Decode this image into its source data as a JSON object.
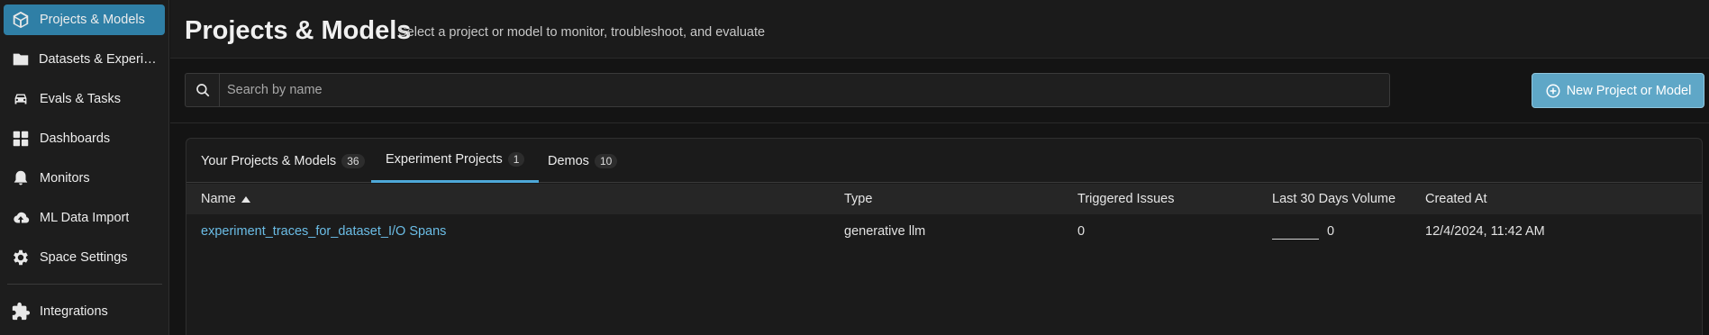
{
  "sidebar": {
    "items": [
      {
        "label": "Projects & Models",
        "icon": "cube-icon",
        "active": true
      },
      {
        "label": "Datasets & Experiments",
        "icon": "folder-icon",
        "active": false
      },
      {
        "label": "Evals & Tasks",
        "icon": "car-icon",
        "active": false
      },
      {
        "label": "Dashboards",
        "icon": "grid-icon",
        "active": false
      },
      {
        "label": "Monitors",
        "icon": "bell-icon",
        "active": false
      },
      {
        "label": "ML Data Import",
        "icon": "cloud-upload-icon",
        "active": false
      },
      {
        "label": "Space Settings",
        "icon": "gear-icon",
        "active": false
      },
      {
        "label": "Integrations",
        "icon": "puzzle-icon",
        "active": false
      }
    ]
  },
  "header": {
    "title": "Projects & Models",
    "subtitle": "Select a project or model to monitor, troubleshoot, and evaluate"
  },
  "search": {
    "placeholder": "Search by name",
    "value": ""
  },
  "actions": {
    "new_label": "New Project or Model"
  },
  "tabs": [
    {
      "label": "Your Projects & Models",
      "count": "36",
      "active": false
    },
    {
      "label": "Experiment Projects",
      "count": "1",
      "active": true
    },
    {
      "label": "Demos",
      "count": "10",
      "active": false
    }
  ],
  "table": {
    "columns": [
      "Name",
      "Type",
      "Triggered Issues",
      "Last 30 Days Volume",
      "Created At"
    ],
    "sort_column": "Name",
    "sort_direction": "ascending",
    "rows": [
      {
        "name": "experiment_traces_for_dataset_I/O Spans",
        "type": "generative llm",
        "triggered_issues": "0",
        "volume": "0",
        "created_at": "12/4/2024, 11:42 AM"
      }
    ]
  },
  "colors": {
    "accent": "#2f7fa6",
    "button": "#5fa7c7",
    "link": "#6bbde6",
    "tab_underline": "#4ea8d8"
  }
}
